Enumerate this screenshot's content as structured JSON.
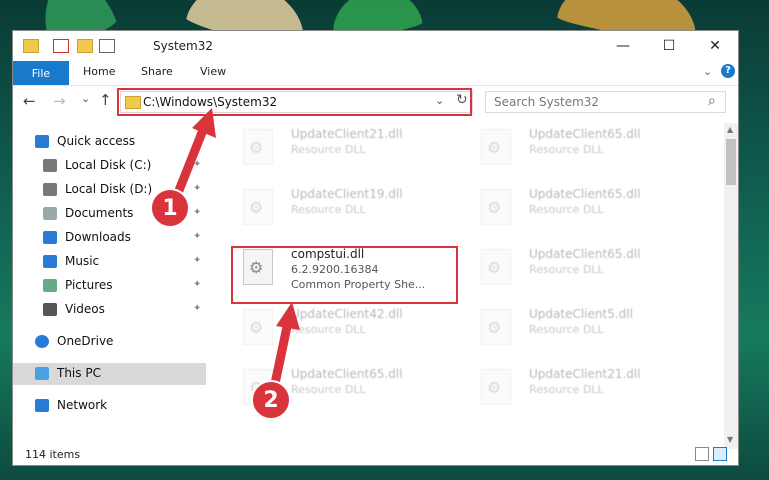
{
  "window": {
    "title": "System32",
    "minimize": "—",
    "maximize": "☐",
    "close": "✕"
  },
  "ribbon": {
    "file": "File",
    "home": "Home",
    "share": "Share",
    "view": "View",
    "collapse": "⌄",
    "help": "?"
  },
  "nav": {
    "back": "←",
    "forward": "→",
    "recent": "⌄",
    "up": "↑"
  },
  "address": {
    "path": "C:\\Windows\\System32",
    "dropdown": "⌄",
    "refresh": "↻"
  },
  "search": {
    "placeholder": "Search System32",
    "icon": "⌕"
  },
  "sidebar": {
    "items": [
      {
        "label": "Quick access",
        "icon": "star-icon"
      },
      {
        "label": "Local Disk (C:)",
        "icon": "drive-icon",
        "pinned": true
      },
      {
        "label": "Local Disk (D:)",
        "icon": "drive-icon",
        "pinned": true
      },
      {
        "label": "Documents",
        "icon": "document-icon",
        "pinned": true
      },
      {
        "label": "Downloads",
        "icon": "download-icon",
        "pinned": true
      },
      {
        "label": "Music",
        "icon": "music-icon",
        "pinned": true
      },
      {
        "label": "Pictures",
        "icon": "picture-icon",
        "pinned": true
      },
      {
        "label": "Videos",
        "icon": "video-icon",
        "pinned": true
      },
      {
        "label": "OneDrive",
        "icon": "cloud-icon"
      },
      {
        "label": "This PC",
        "icon": "pc-icon",
        "selected": true
      },
      {
        "label": "Network",
        "icon": "network-icon"
      }
    ]
  },
  "files": {
    "items": [
      {
        "name": "UpdateClient21.dll",
        "desc": "Resource DLL"
      },
      {
        "name": "UpdateClient65.dll",
        "desc": "Resource DLL"
      },
      {
        "name": "UpdateClient19.dll",
        "desc": "Resource DLL"
      },
      {
        "name": "UpdateClient65.dll",
        "desc": "Resource DLL"
      },
      {
        "name": "compstui.dll",
        "desc": "6.2.9200.16384",
        "desc2": "Common Property She..."
      },
      {
        "name": "UpdateClient65.dll",
        "desc": "Resource DLL"
      },
      {
        "name": "UpdateClient42.dll",
        "desc": "Resource DLL"
      },
      {
        "name": "UpdateClient5.dll",
        "desc": "Resource DLL"
      },
      {
        "name": "UpdateClient65.dll",
        "desc": "Resource DLL"
      },
      {
        "name": "UpdateClient21.dll",
        "desc": "Resource DLL"
      }
    ]
  },
  "status": {
    "count": "114 items"
  },
  "callouts": {
    "one": "1",
    "two": "2"
  },
  "colors": {
    "accent": "#1979ca",
    "highlight": "#d9343b"
  }
}
